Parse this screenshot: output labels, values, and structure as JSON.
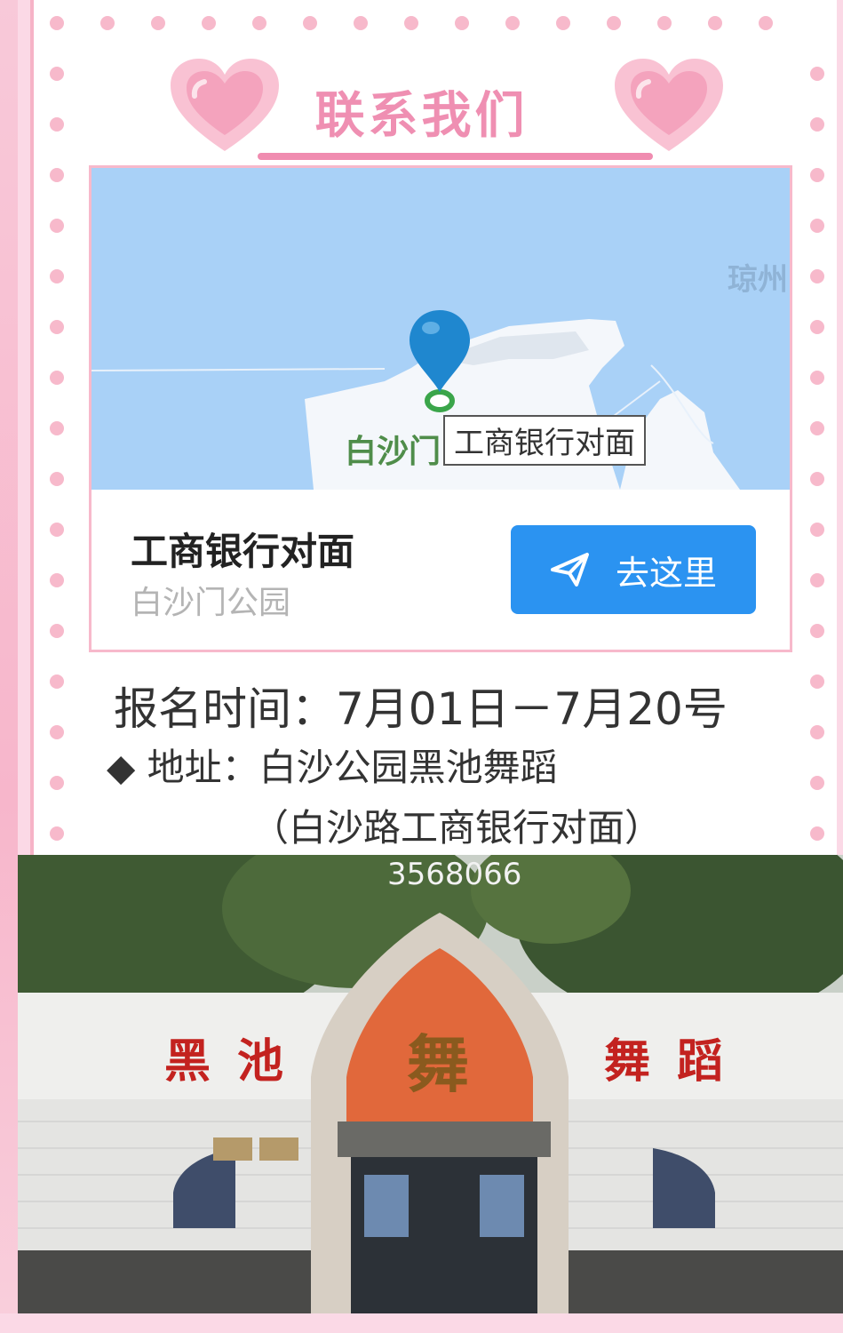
{
  "header": {
    "title": "联系我们"
  },
  "map": {
    "region_label": "琼州",
    "place_label": "白沙门",
    "tooltip": "工商银行对面"
  },
  "location": {
    "name": "工商银行对面",
    "subtitle": "白沙门公园",
    "go_button_label": "去这里"
  },
  "info": {
    "registration_time": "报名时间：7月01日－7月20号",
    "address_bullet": "◆",
    "address_line": "地址：白沙公园黑池舞蹈",
    "address_note": "（白沙路工商银行对面）"
  },
  "photo": {
    "overlay_text": "3568066",
    "sign_left": "黑池",
    "sign_right": "舞蹈",
    "sign_center": "舞"
  },
  "colors": {
    "accent_pink": "#ef8fb2",
    "frame_pink": "#f7b9cb",
    "button_blue": "#2b93f1",
    "map_water": "#a9d1f7"
  }
}
